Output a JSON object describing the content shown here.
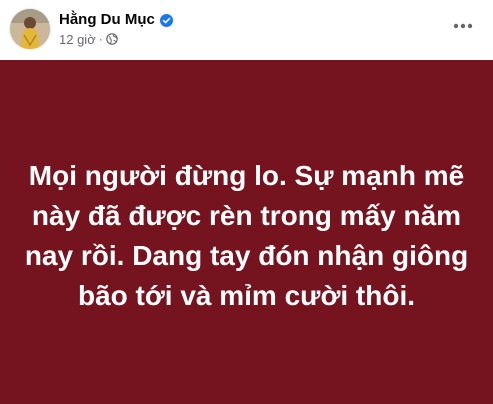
{
  "post": {
    "author": {
      "name": "Hằng Du Mục",
      "verified": true
    },
    "meta": {
      "time": "12 giờ",
      "separator": "·",
      "audience_icon": "globe-icon"
    },
    "more_icon": "more-horizontal-icon",
    "status_text": "Mọi người đừng lo. Sự mạnh mẽ này đã được rèn trong mấy năm nay rồi. Dang tay đón nhận giông bão tới và mỉm cười thôi.",
    "background_color": "#75141f",
    "text_color": "#ffffff"
  },
  "colors": {
    "verified_badge": "#1877f2",
    "meta_text": "#65676b",
    "name_text": "#050505"
  }
}
